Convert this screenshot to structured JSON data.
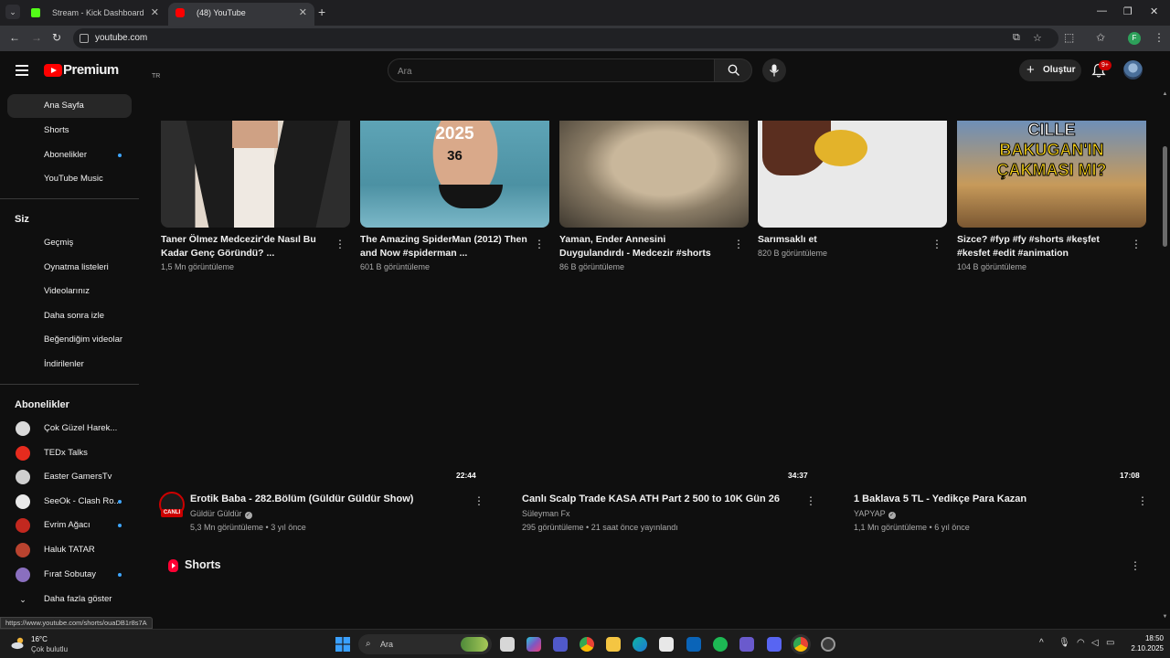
{
  "browser": {
    "tabs": [
      {
        "title": "Stream - Kick Dashboard",
        "active": false
      },
      {
        "title": "(48) YouTube",
        "active": true
      }
    ],
    "url": "youtube.com",
    "profile_initial": "F"
  },
  "masthead": {
    "logo_text": "Premium",
    "country_code": "TR",
    "search_placeholder": "Ara",
    "create_label": "Oluştur",
    "notifications_badge": "9+"
  },
  "sidebar": {
    "main": [
      {
        "label": "Ana Sayfa",
        "active": true
      },
      {
        "label": "Shorts"
      },
      {
        "label": "Abonelikler",
        "dot": true
      },
      {
        "label": "YouTube Music"
      }
    ],
    "you_heading": "Siz",
    "you": [
      {
        "label": "Geçmiş"
      },
      {
        "label": "Oynatma listeleri"
      },
      {
        "label": "Videolarınız"
      },
      {
        "label": "Daha sonra izle"
      },
      {
        "label": "Beğendiğim videolar"
      },
      {
        "label": "İndirilenler"
      }
    ],
    "subs_heading": "Abonelikler",
    "subscriptions": [
      {
        "label": "Çok Güzel Harek...",
        "color": "#d9d9d9"
      },
      {
        "label": "TEDx Talks",
        "color": "#e62b1e"
      },
      {
        "label": "Easter GamersTv",
        "color": "#cfcfcf"
      },
      {
        "label": "SeeOk - Clash Ro...",
        "color": "#e9e9e9",
        "dot": true
      },
      {
        "label": "Evrim Ağacı",
        "color": "#c2281f",
        "dot": true
      },
      {
        "label": "Haluk TATAR",
        "color": "#b9432f"
      },
      {
        "label": "Fırat Sobutay",
        "color": "#8a6fbf",
        "dot": true
      }
    ],
    "show_more": "Daha fazla göster"
  },
  "shorts_row": [
    {
      "title": "Taner Ölmez Medcezir'de Nasıl Bu Kadar Genç Göründü? ...",
      "views": "1,5 Mn görüntüleme"
    },
    {
      "title": "The Amazing SpiderMan (2012) Then and Now #spiderman ...",
      "views": "601 B görüntüleme",
      "overlay_year": "2025",
      "overlay_num": "36"
    },
    {
      "title": "Yaman, Ender Annesini Duygulandırdı - Medcezir #shorts",
      "views": "86 B görüntüleme"
    },
    {
      "title": "Sarımsaklı et",
      "views": "820 B görüntüleme"
    },
    {
      "title": "Sizce? #fyp #fy #shorts #keşfet #kesfet #edit #animation",
      "views": "104 B görüntüleme",
      "overlay_line1": "CILLE",
      "overlay_line2": "BAKUGAN'IN",
      "overlay_line3": "ÇAKMASI MI?"
    }
  ],
  "videos": [
    {
      "duration": "22:44",
      "title": "Erotik Baba - 282.Bölüm (Güldür Güldür Show)",
      "channel": "Güldür Güldür",
      "verified": true,
      "meta": "5,3 Mn görüntüleme • 3 yıl önce",
      "live_badge": "CANLI"
    },
    {
      "duration": "34:37",
      "title": "Canlı Scalp Trade  KASA ATH  Part 2   500 to 10K Gün 26",
      "channel": "Süleyman Fx",
      "verified": false,
      "meta": "295 görüntüleme • 21 saat önce yayınlandı"
    },
    {
      "duration": "17:08",
      "title": "1 Baklava 5 TL - Yedikçe Para Kazan",
      "channel": "YAPYAP",
      "verified": true,
      "meta": "1,1 Mn görüntüleme • 6 yıl önce"
    }
  ],
  "shorts_section_label": "Shorts",
  "status_url": "https://www.youtube.com/shorts/ouaDB1r8s7A",
  "taskbar": {
    "weather_temp": "16°C",
    "weather_desc": "Çok bulutlu",
    "search_label": "Ara",
    "time": "18:50",
    "date": "2.10.2025"
  }
}
